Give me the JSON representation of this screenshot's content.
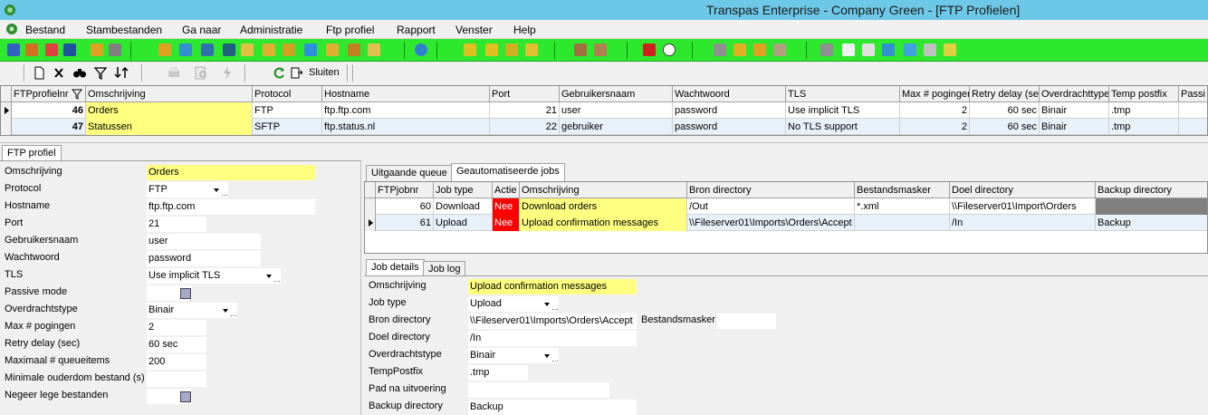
{
  "window": {
    "title": "Transpas Enterprise - Company Green - [FTP Profielen]"
  },
  "menu": [
    "Bestand",
    "Stambestanden",
    "Ga naar",
    "Administratie",
    "Ftp profiel",
    "Rapport",
    "Venster",
    "Help"
  ],
  "toolbar2": {
    "close_label": "Sluiten"
  },
  "profiles_grid": {
    "columns": [
      "FTPprofielnr",
      "Omschrijving",
      "Protocol",
      "Hostname",
      "Port",
      "Gebruikersnaam",
      "Wachtwoord",
      "TLS",
      "Max # pogingen",
      "Retry delay (sec)",
      "Overdrachttype",
      "Temp postfix",
      "Passi"
    ],
    "rows": [
      [
        "46",
        "Orders",
        "FTP",
        "ftp.ftp.com",
        "21",
        "user",
        "password",
        "Use implicit TLS",
        "2",
        "60 sec",
        "Binair",
        ".tmp"
      ],
      [
        "47",
        "Statussen",
        "SFTP",
        "ftp.status.nl",
        "22",
        "gebruiker",
        "password",
        "No TLS support",
        "2",
        "60 sec",
        "Binair",
        ".tmp"
      ]
    ]
  },
  "ftp_tab": {
    "label": "FTP profiel"
  },
  "profile_form": {
    "labels": [
      "Omschrijving",
      "Protocol",
      "Hostname",
      "Port",
      "Gebruikersnaam",
      "Wachtwoord",
      "TLS",
      "Passive mode",
      "Overdrachtstype",
      "Max # pogingen",
      "Retry delay (sec)",
      "Maximaal # queueitems",
      "Minimale ouderdom bestand (s)",
      "Negeer lege bestanden"
    ],
    "omschrijving": "Orders",
    "protocol": "FTP",
    "hostname": "ftp.ftp.com",
    "port": "21",
    "gebruikersnaam": "user",
    "wachtwoord": "password",
    "tls": "Use implicit TLS",
    "overdrachtstype": "Binair",
    "max_pogingen": "2",
    "retry_delay": "60 sec",
    "max_queueitems": "200",
    "min_ouderdom": ""
  },
  "jobs_tabs": [
    "Uitgaande queue",
    "Geautomatiseerde jobs"
  ],
  "jobs_grid": {
    "columns": [
      "FTPjobnr",
      "Job type",
      "Actie",
      "Omschrijving",
      "Bron directory",
      "Bestandsmasker",
      "Doel directory",
      "Backup directory"
    ],
    "rows": [
      [
        "60",
        "Download",
        "Nee",
        "Download orders",
        "/Out",
        "*.xml",
        "\\\\Fileserver01\\Import\\Orders",
        ""
      ],
      [
        "61",
        "Upload",
        "Nee",
        "Upload confirmation messages",
        "\\\\Fileserver01\\Imports\\Orders\\Accept",
        "",
        "/In",
        "Backup"
      ]
    ]
  },
  "details_tabs": [
    "Job details",
    "Job log"
  ],
  "job_form": {
    "labels": [
      "Omschrijving",
      "Job type",
      "Bron directory",
      "Doel directory",
      "Overdrachtstype",
      "TempPostfix",
      "Pad na uitvoering",
      "Backup directory"
    ],
    "bestandsmasker_label": "Bestandsmasker",
    "omschrijving": "Upload confirmation messages",
    "job_type": "Upload",
    "bron_directory": "\\\\Fileserver01\\Imports\\Orders\\Accept",
    "bestandsmasker": "",
    "doel_directory": "/In",
    "overdrachtstype": "Binair",
    "temp_postfix": ".tmp",
    "pad_na_uitvoering": "",
    "backup_directory": "Backup"
  },
  "colors": {
    "titlebar": "#6dc8e8",
    "toolbar": "#2ee82e",
    "highlight": "#ffff80",
    "alert": "#ff0000"
  }
}
